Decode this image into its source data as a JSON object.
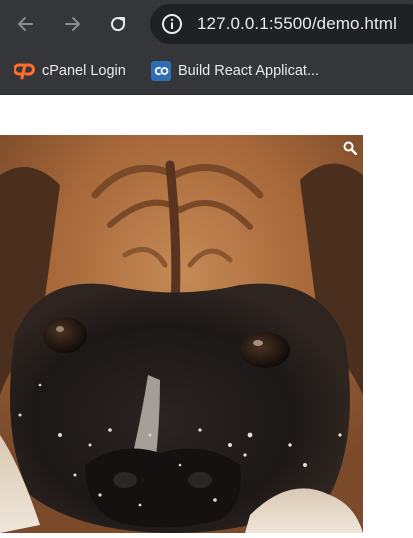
{
  "browser": {
    "url_host": "127.0.0.1",
    "url_rest": ":5500/demo.html",
    "back_icon": "arrow-left-icon",
    "forward_icon": "arrow-right-icon",
    "reload_icon": "reload-icon",
    "info_icon": "info-icon"
  },
  "bookmarks": [
    {
      "label": "cPanel Login",
      "icon": "cpanel-icon"
    },
    {
      "label": "Build React Applicat...",
      "icon": "codecademy-icon"
    }
  ],
  "page": {
    "image_subject": "boxer dog face",
    "zoom_icon": "magnifier-icon"
  },
  "colors": {
    "chrome": "#35363a",
    "omnibox": "#202124",
    "cpanel_orange": "#ff6c2c",
    "codecademy_blue": "#2f6db5"
  }
}
